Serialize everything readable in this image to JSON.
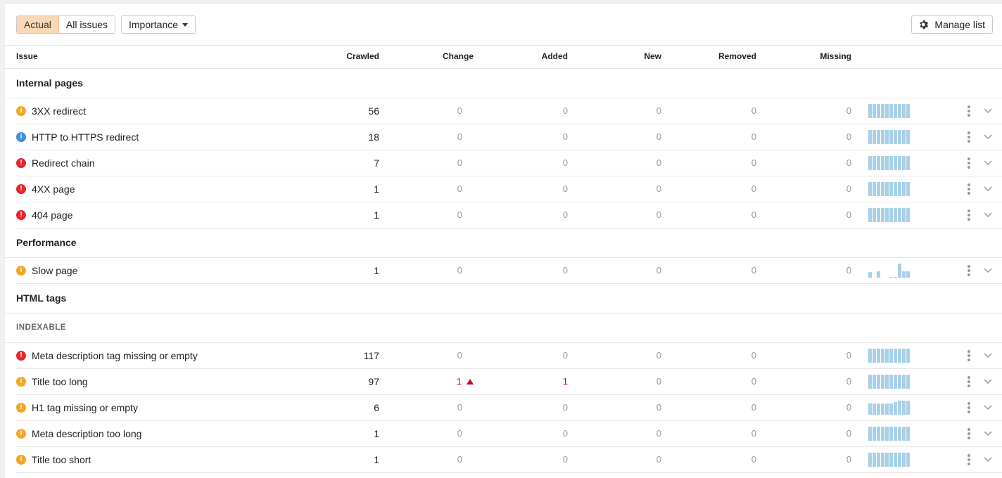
{
  "toolbar": {
    "tabs": [
      "Actual",
      "All issues"
    ],
    "active_tab": "Actual",
    "dropdown_label": "Importance",
    "manage_label": "Manage list"
  },
  "columns": {
    "issue": "Issue",
    "crawled": "Crawled",
    "change": "Change",
    "added": "Added",
    "new": "New",
    "removed": "Removed",
    "missing": "Missing"
  },
  "colors": {
    "warning": "#f5a623",
    "info": "#3d8fd8",
    "error": "#e8262c",
    "highlight": "#d0021b",
    "active_tab_bg": "#fcd7b5",
    "sparkline": "#a8d0e8"
  },
  "groups": [
    {
      "title": "Internal pages",
      "subgroup": "",
      "rows": [
        {
          "icon": "warning",
          "name": "3XX redirect",
          "crawled": "56",
          "change": "0",
          "change_up": false,
          "added": "0",
          "new": "0",
          "removed": "0",
          "missing": "0",
          "trend": [
            1,
            1,
            1,
            1,
            1,
            1,
            1,
            1,
            1,
            1
          ]
        },
        {
          "icon": "info",
          "name": "HTTP to HTTPS redirect",
          "crawled": "18",
          "change": "0",
          "change_up": false,
          "added": "0",
          "new": "0",
          "removed": "0",
          "missing": "0",
          "trend": [
            1,
            1,
            1,
            1,
            1,
            1,
            1,
            1,
            1,
            1
          ]
        },
        {
          "icon": "error",
          "name": "Redirect chain",
          "crawled": "7",
          "change": "0",
          "change_up": false,
          "added": "0",
          "new": "0",
          "removed": "0",
          "missing": "0",
          "trend": [
            1,
            1,
            1,
            1,
            1,
            1,
            1,
            1,
            1,
            1
          ]
        },
        {
          "icon": "error",
          "name": "4XX page",
          "crawled": "1",
          "change": "0",
          "change_up": false,
          "added": "0",
          "new": "0",
          "removed": "0",
          "missing": "0",
          "trend": [
            1,
            1,
            1,
            1,
            1,
            1,
            1,
            1,
            1,
            1
          ]
        },
        {
          "icon": "error",
          "name": "404 page",
          "crawled": "1",
          "change": "0",
          "change_up": false,
          "added": "0",
          "new": "0",
          "removed": "0",
          "missing": "0",
          "trend": [
            1,
            1,
            1,
            1,
            1,
            1,
            1,
            1,
            1,
            1
          ]
        }
      ]
    },
    {
      "title": "Performance",
      "subgroup": "",
      "rows": [
        {
          "icon": "warning",
          "name": "Slow page",
          "crawled": "1",
          "change": "0",
          "change_up": false,
          "added": "0",
          "new": "0",
          "removed": "0",
          "missing": "0",
          "trend": [
            0.4,
            0,
            0.45,
            0,
            0,
            0.05,
            0.05,
            1,
            0.45,
            0.45
          ]
        }
      ]
    },
    {
      "title": "HTML tags",
      "subgroup": "INDEXABLE",
      "rows": [
        {
          "icon": "error",
          "name": "Meta description tag missing or empty",
          "crawled": "117",
          "change": "0",
          "change_up": false,
          "added": "0",
          "new": "0",
          "removed": "0",
          "missing": "0",
          "trend": [
            1,
            1,
            1,
            1,
            1,
            1,
            1,
            1,
            1,
            1
          ]
        },
        {
          "icon": "warning",
          "name": "Title too long",
          "crawled": "97",
          "change": "1",
          "change_up": true,
          "added": "1",
          "new": "0",
          "removed": "0",
          "missing": "0",
          "trend": [
            1,
            1,
            1,
            1,
            1,
            1,
            1,
            1,
            1,
            1
          ]
        },
        {
          "icon": "warning",
          "name": "H1 tag missing or empty",
          "crawled": "6",
          "change": "0",
          "change_up": false,
          "added": "0",
          "new": "0",
          "removed": "0",
          "missing": "0",
          "trend": [
            0.8,
            0.8,
            0.8,
            0.8,
            0.8,
            0.8,
            0.9,
            1,
            1,
            1
          ]
        },
        {
          "icon": "warning",
          "name": "Meta description too long",
          "crawled": "1",
          "change": "0",
          "change_up": false,
          "added": "0",
          "new": "0",
          "removed": "0",
          "missing": "0",
          "trend": [
            1,
            1,
            1,
            1,
            1,
            1,
            1,
            1,
            1,
            1
          ]
        },
        {
          "icon": "warning",
          "name": "Title too short",
          "crawled": "1",
          "change": "0",
          "change_up": false,
          "added": "0",
          "new": "0",
          "removed": "0",
          "missing": "0",
          "trend": [
            1,
            1,
            1,
            1,
            1,
            1,
            1,
            1,
            1,
            1
          ]
        }
      ]
    }
  ]
}
